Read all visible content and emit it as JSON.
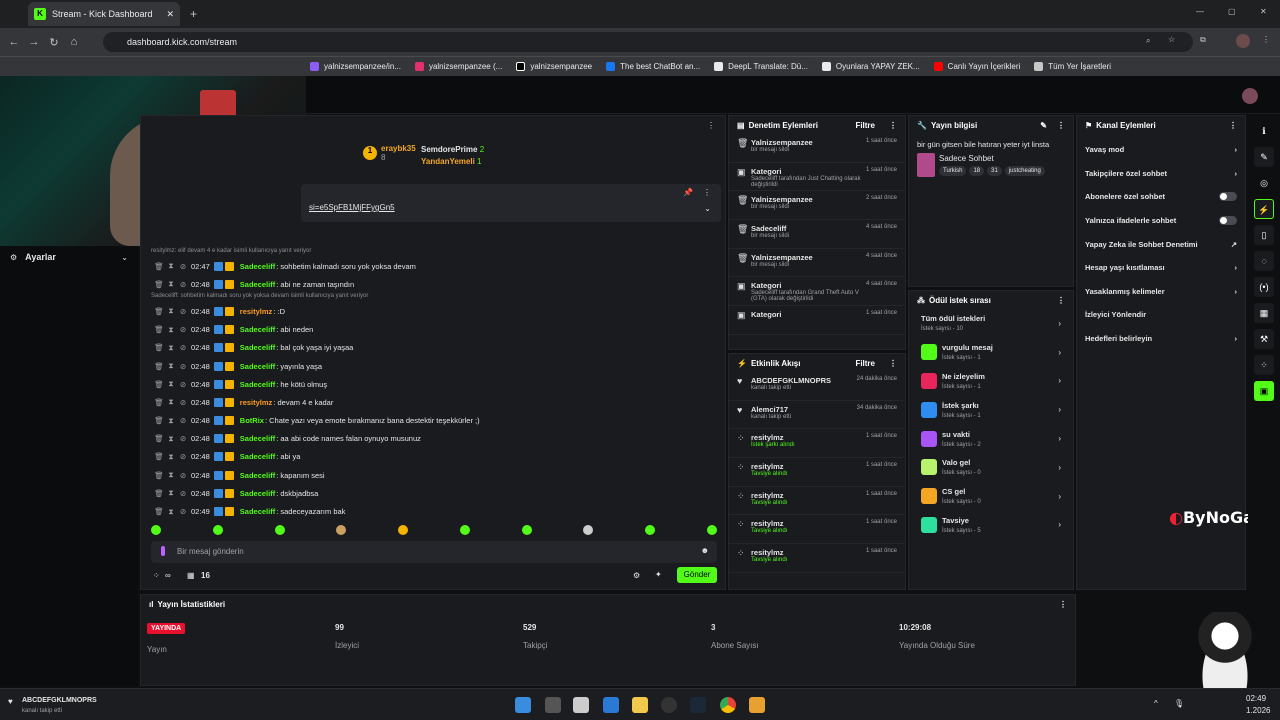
{
  "browser": {
    "tab_title": "Stream - Kick Dashboard",
    "url": "dashboard.kick.com/stream",
    "bookmarks": [
      "yalnizsempanzee",
      "yalnizsempanzee/in...",
      "yalnizsempanzee (...",
      "yalnizsempanzee",
      "The best ChatBot an...",
      "DeepL Translate: Dü...",
      "Oyunlara YAPAY ZEK...",
      "Canlı Yayın İçerikleri"
    ],
    "bookmarks_more": "Tüm Yer İşaretleri"
  },
  "left": {
    "settings_label": "Ayarlar"
  },
  "chat": {
    "top_users": [
      {
        "name": "eraybk35",
        "count": "8",
        "badge": "1"
      },
      {
        "name": "SemdorePrime",
        "count": "2"
      },
      {
        "name": "YandanYemeli",
        "count": "1"
      }
    ],
    "pinned_link": "si=e5SpFB1MjFFygGn5",
    "reply_1": "resitylmz: elif devam 4 e kadar isimli kullanıcıya yanıt veriyor",
    "reply_2": "Sadeceliff: sohbetim kalmadı soru yok yoksa devam isimli kullanıcıya yanıt veriyor",
    "messages": [
      {
        "time": "02:47",
        "user": "Sadeceliff",
        "text": "sohbetim kalmadı soru yok yoksa devam",
        "color": "#53fc18"
      },
      {
        "time": "02:48",
        "user": "Sadeceliff",
        "text": "abi ne zaman taşındın",
        "color": "#53fc18"
      },
      {
        "time": "02:48",
        "user": "resitylmz",
        "text": ":D",
        "color": "#ff9d1e"
      },
      {
        "time": "02:48",
        "user": "Sadeceliff",
        "text": "abi neden",
        "color": "#53fc18"
      },
      {
        "time": "02:48",
        "user": "Sadeceliff",
        "text": "bal çok yaşa iyi yaşaa",
        "color": "#53fc18"
      },
      {
        "time": "02:48",
        "user": "Sadeceliff",
        "text": "yayınla yaşa",
        "color": "#53fc18"
      },
      {
        "time": "02:48",
        "user": "Sadeceliff",
        "text": "he kötü olmuş",
        "color": "#53fc18"
      },
      {
        "time": "02:48",
        "user": "resitylmz",
        "text": "devam 4 e kadar",
        "color": "#ff9d1e"
      },
      {
        "time": "02:48",
        "user": "BotRix",
        "text": "Chate yazı veya emote bırakmanız bana destektir teşekkürler ;)",
        "color": "#53fc18"
      },
      {
        "time": "02:48",
        "user": "Sadeceliff",
        "text": "aa abi code names falan oynuyo musunuz",
        "color": "#53fc18"
      },
      {
        "time": "02:48",
        "user": "Sadeceliff",
        "text": "abi ya",
        "color": "#53fc18"
      },
      {
        "time": "02:48",
        "user": "Sadeceliff",
        "text": "kapanım sesi",
        "color": "#53fc18"
      },
      {
        "time": "02:48",
        "user": "Sadeceliff",
        "text": "dskbjadbsa",
        "color": "#53fc18"
      },
      {
        "time": "02:49",
        "user": "Sadeceliff",
        "text": "sadeceyazarım bak",
        "color": "#53fc18"
      }
    ],
    "input_placeholder": "Bir mesaj gönderin",
    "viewers_icon_label": "∞",
    "count_label": "16",
    "send_label": "Gönder"
  },
  "modlog": {
    "title": "Denetim Eylemleri",
    "filter": "Filtre",
    "items": [
      {
        "name": "Yalnizsempanzee",
        "detail": "bir mesajı sildi",
        "time": "1 saat önce"
      },
      {
        "name": "Kategori",
        "detail": "Sadeceliff tarafından Just Chatting olarak değiştirildi",
        "time": "1 saat önce"
      },
      {
        "name": "Yalnizsempanzee",
        "detail": "bir mesajı sildi",
        "time": "2 saat önce"
      },
      {
        "name": "Sadeceliff",
        "detail": "bir mesajı sildi",
        "time": "4 saat önce"
      },
      {
        "name": "Yalnizsempanzee",
        "detail": "bir mesajı sildi",
        "time": "4 saat önce"
      },
      {
        "name": "Kategori",
        "detail": "Sadeceliff tarafından Grand Theft Auto V (GTA) olarak değiştirildi",
        "time": "4 saat önce"
      },
      {
        "name": "Kategori",
        "detail": "",
        "time": "1 saat önce"
      }
    ]
  },
  "activity": {
    "title": "Etkinlik Akışı",
    "filter": "Filtre",
    "items": [
      {
        "name": "ABCDEFGKLMNOPRS",
        "detail": "kanalı takip etti",
        "time": "24 dakika önce"
      },
      {
        "name": "Alemci717",
        "detail": "kanalı takip etti",
        "time": "34 dakika önce"
      },
      {
        "name": "resitylmz",
        "detail": "İstek şarkı alındı",
        "time": "1 saat önce"
      },
      {
        "name": "resitylmz",
        "detail": "Tavsiye alındı",
        "time": "1 saat önce"
      },
      {
        "name": "resitylmz",
        "detail": "Tavsiye alındı",
        "time": "1 saat önce"
      },
      {
        "name": "resitylmz",
        "detail": "Tavsiye alındı",
        "time": "1 saat önce"
      },
      {
        "name": "resitylmz",
        "detail": "Tavsiye alındı",
        "time": "1 saat önce"
      }
    ]
  },
  "streaminfo": {
    "title": "Yayın bilgisi",
    "stream_title": "bir gün gitsen bile hatıran yeter iyt linsta",
    "category": "Sadece Sohbet",
    "tags": [
      "Turkish",
      "18",
      "31",
      "justcheating"
    ]
  },
  "rewards": {
    "title": "Ödül istek sırası",
    "all_label": "Tüm ödül istekleri",
    "all_count": "İstek sayısı - 10",
    "items": [
      {
        "name": "vurgulu mesaj",
        "count": "İstek sayısı - 1",
        "color": "#53fc18"
      },
      {
        "name": "Ne izleyelim",
        "count": "İstek sayısı - 1",
        "color": "#e8265b"
      },
      {
        "name": "İstek şarkı",
        "count": "İstek sayısı - 1",
        "color": "#2f8cf0"
      },
      {
        "name": "su vakti",
        "count": "İstek sayısı - 2",
        "color": "#a855f7"
      },
      {
        "name": "Valo gel",
        "count": "İstek sayısı - 0",
        "color": "#b9f26b"
      },
      {
        "name": "CS gel",
        "count": "İstek sayısı - 0",
        "color": "#f5a623"
      },
      {
        "name": "Tavsiye",
        "count": "İstek sayısı - 5",
        "color": "#2de0a0"
      }
    ]
  },
  "actions": {
    "title": "Kanal Eylemleri",
    "items": [
      {
        "label": "Yavaş mod",
        "kind": "chevron"
      },
      {
        "label": "Takipçilere özel sohbet",
        "kind": "chevron"
      },
      {
        "label": "Abonelere özel sohbet",
        "kind": "toggle"
      },
      {
        "label": "Yalnızca ifadelerle sohbet",
        "kind": "toggle"
      },
      {
        "label": "Yapay Zeka ile Sohbet Denetimi",
        "kind": "link"
      },
      {
        "label": "Hesap yaşı kısıtlaması",
        "kind": "chevron"
      },
      {
        "label": "Yasaklanmış kelimeler",
        "kind": "chevron"
      },
      {
        "label": "İzleyici Yönlendir",
        "kind": "none"
      },
      {
        "label": "Hedefleri belirleyin",
        "kind": "chevron"
      }
    ]
  },
  "stats": {
    "title": "Yayın İstatistikleri",
    "live_badge": "YAYINDA",
    "live_label": "Yayın",
    "viewers_value": "99",
    "viewers_label": "İzleyici",
    "followers_value": "529",
    "followers_label": "Takipçi",
    "subs_value": "3",
    "subs_label": "Abone Sayısı",
    "duration_value": "10:29:08",
    "duration_label": "Yayında Olduğu Süre"
  },
  "watermark": "ByNoGame",
  "notification": {
    "name": "ABCDEFGKLMNOPRS",
    "detail": "kanalı takip etti"
  },
  "clock": {
    "time": "02:49",
    "date": "1.2026"
  }
}
